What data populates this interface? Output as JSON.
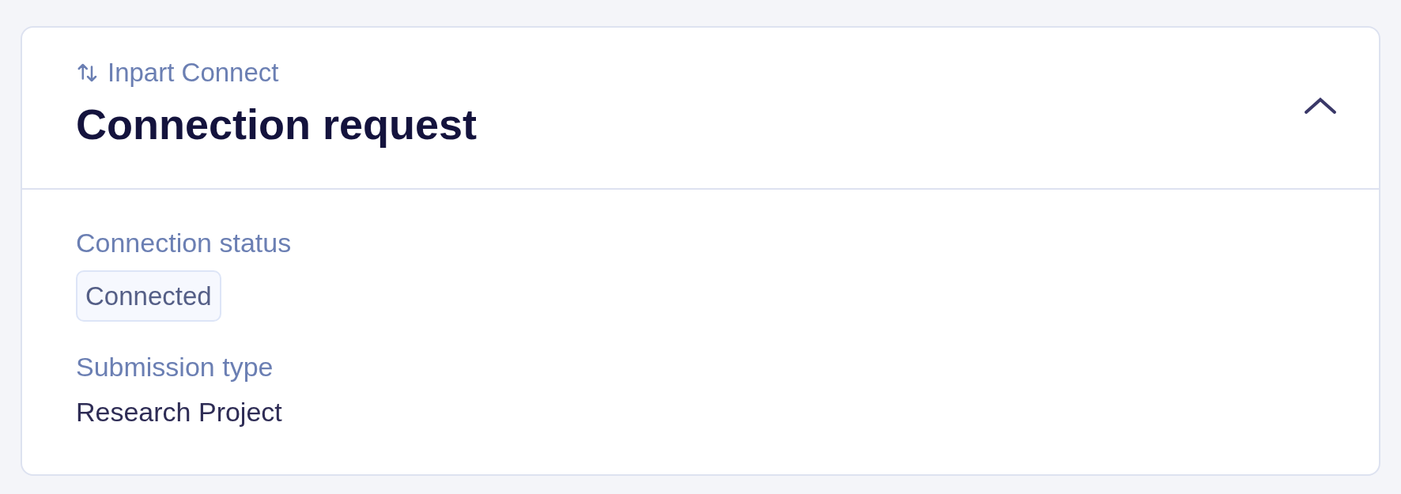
{
  "card": {
    "eyebrow": "Inpart Connect",
    "title": "Connection request",
    "expanded": true,
    "fields": [
      {
        "kind": "badge",
        "label": "Connection status",
        "value": "Connected"
      },
      {
        "kind": "text",
        "label": "Submission type",
        "value": "Research Project"
      }
    ]
  }
}
